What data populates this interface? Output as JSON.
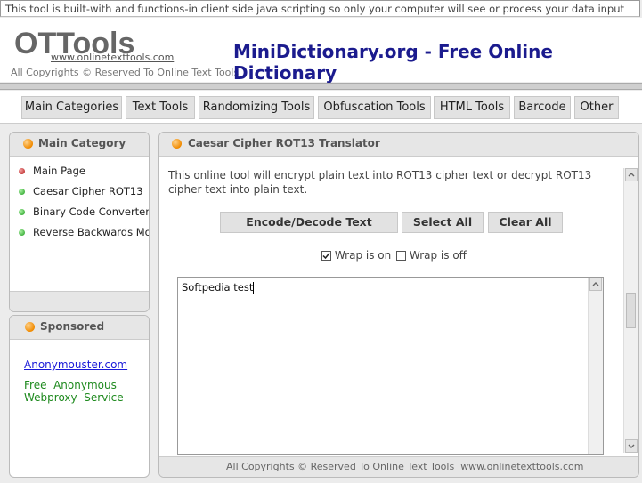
{
  "notice": "This tool is built-with and functions-in client side java scripting so only your computer will see or process your data input and output.",
  "header": {
    "brand": "OTTools",
    "brand_url": "www.onlinetexttools.com",
    "copyright": "All Copyrights © Reserved To Online Text Tools",
    "site_title": "MiniDictionary.org - Free Online Dictionary"
  },
  "nav": {
    "items": [
      "Main Categories",
      "Text Tools",
      "Randomizing Tools",
      "Obfuscation Tools",
      "HTML Tools",
      "Barcode",
      "Other"
    ]
  },
  "sidebar": {
    "title": "Main Category",
    "items": [
      {
        "label": "Main Page",
        "color": "#b01010"
      },
      {
        "label": "Caesar Cipher ROT13",
        "color": "#1b9a1b"
      },
      {
        "label": "Binary Code Converter",
        "color": "#1b9a1b"
      },
      {
        "label": "Reverse Backwards More",
        "color": "#1b9a1b"
      }
    ]
  },
  "sponsored": {
    "title": "Sponsored",
    "link": "Anonymouster.com",
    "desc_line1": "Free  Anonymous",
    "desc_line2": "Webproxy  Service"
  },
  "main": {
    "title": "Caesar Cipher ROT13 Translator",
    "description": "This online tool will encrypt plain text into ROT13 cipher text or decrypt ROT13 cipher text into plain text.",
    "buttons": {
      "encode": "Encode/Decode Text",
      "select_all": "Select All",
      "clear_all": "Clear All"
    },
    "wrap_on_label": "Wrap is on",
    "wrap_off_label": "Wrap is off",
    "textarea_value": "Softpedia test",
    "footer": "All Copyrights © Reserved To Online Text Tools  www.onlinetexttools.com"
  }
}
